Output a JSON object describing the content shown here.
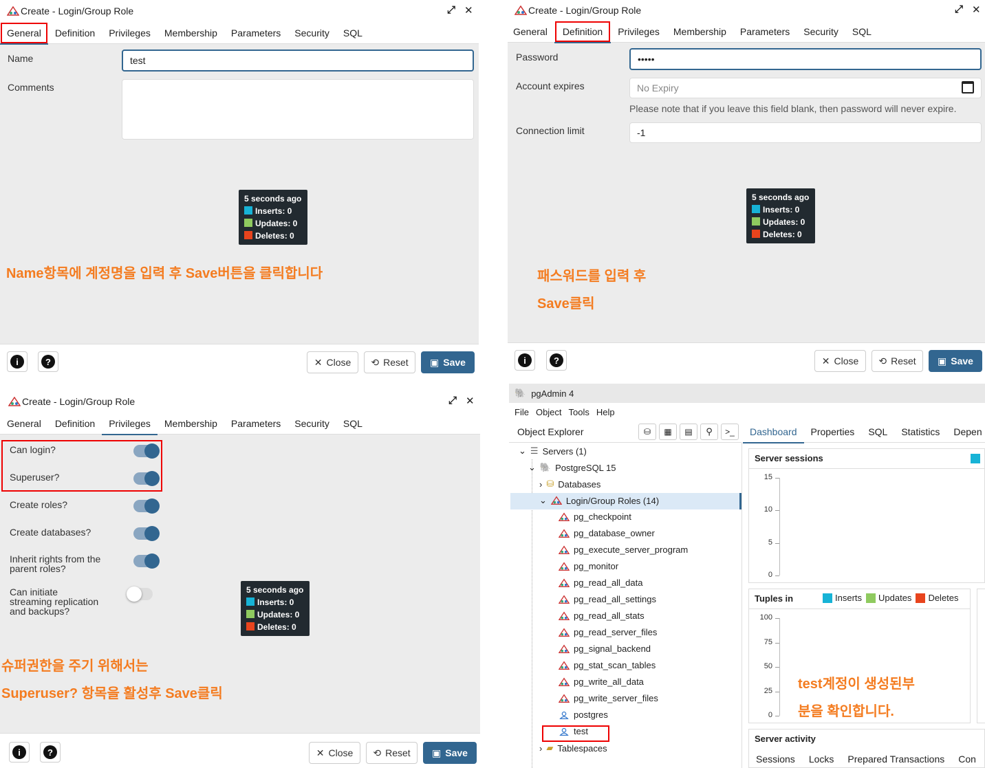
{
  "dialog_general": {
    "title": "Create - Login/Group Role",
    "tabs": [
      "General",
      "Definition",
      "Privileges",
      "Membership",
      "Parameters",
      "Security",
      "SQL"
    ],
    "name_label": "Name",
    "name_value": "test",
    "comments_label": "Comments",
    "note": "Name항목에 계정명을 입력 후 Save버튼을 클릭합니다"
  },
  "dialog_definition": {
    "title": "Create - Login/Group Role",
    "tabs": [
      "General",
      "Definition",
      "Privileges",
      "Membership",
      "Parameters",
      "Security",
      "SQL"
    ],
    "password_label": "Password",
    "password_value": "•••••",
    "expires_label": "Account expires",
    "expires_placeholder": "No Expiry",
    "expires_hint": "Please note that if you leave this field blank, then password will never expire.",
    "connlimit_label": "Connection limit",
    "connlimit_value": "-1",
    "note_line1": "패스워드를 입력 후",
    "note_line2": "Save클릭"
  },
  "dialog_privileges": {
    "title": "Create - Login/Group Role",
    "tabs": [
      "General",
      "Definition",
      "Privileges",
      "Membership",
      "Parameters",
      "Security",
      "SQL"
    ],
    "can_login": "Can login?",
    "superuser": "Superuser?",
    "create_roles": "Create roles?",
    "create_databases": "Create databases?",
    "inherit_line1": "Inherit rights from the",
    "inherit_line2": "parent roles?",
    "replication_line1": "Can initiate",
    "replication_line2": "streaming replication",
    "replication_line3": "and backups?",
    "note_line1": "슈퍼권한을 주기 위해서는",
    "note_line2": "Superuser? 항목을 활성후 Save클릭",
    "toggles": {
      "can_login": true,
      "superuser": true,
      "create_roles": true,
      "create_databases": true,
      "inherit": true,
      "replication": false
    }
  },
  "stats": {
    "time": "5 seconds ago",
    "inserts": "Inserts: 0",
    "updates": "Updates: 0",
    "deletes": "Deletes: 0",
    "colors": {
      "inserts": "#17b3d6",
      "updates": "#8fca5f",
      "deletes": "#e8441d"
    }
  },
  "footer": {
    "info": "i",
    "help": "?",
    "close": "Close",
    "reset": "Reset",
    "save": "Save"
  },
  "pgadmin": {
    "title": "pgAdmin 4",
    "menu": [
      "File",
      "Object",
      "Tools",
      "Help"
    ],
    "object_explorer": "Object Explorer",
    "right_tabs": [
      "Dashboard",
      "Properties",
      "SQL",
      "Statistics",
      "Depen"
    ],
    "tree": {
      "servers": "Servers (1)",
      "server": "PostgreSQL 15",
      "databases": "Databases",
      "roles": "Login/Group Roles (14)",
      "role_items": [
        "pg_checkpoint",
        "pg_database_owner",
        "pg_execute_server_program",
        "pg_monitor",
        "pg_read_all_data",
        "pg_read_all_settings",
        "pg_read_all_stats",
        "pg_read_server_files",
        "pg_signal_backend",
        "pg_stat_scan_tables",
        "pg_write_all_data",
        "pg_write_server_files",
        "postgres",
        "test"
      ],
      "tablespaces": "Tablespaces"
    },
    "server_sessions": "Server sessions",
    "sessions_ticks": [
      "15",
      "10",
      "5",
      "0"
    ],
    "tuples_in": "Tuples in",
    "tuples_legend": [
      "Inserts",
      "Updates",
      "Deletes"
    ],
    "tuples_ticks": [
      "100",
      "75",
      "50",
      "25",
      "0"
    ],
    "server_activity": "Server activity",
    "activity_tabs": [
      "Sessions",
      "Locks",
      "Prepared Transactions",
      "Con"
    ],
    "note_line1": "test계정이 생성된부",
    "note_line2": "분을 확인합니다."
  }
}
